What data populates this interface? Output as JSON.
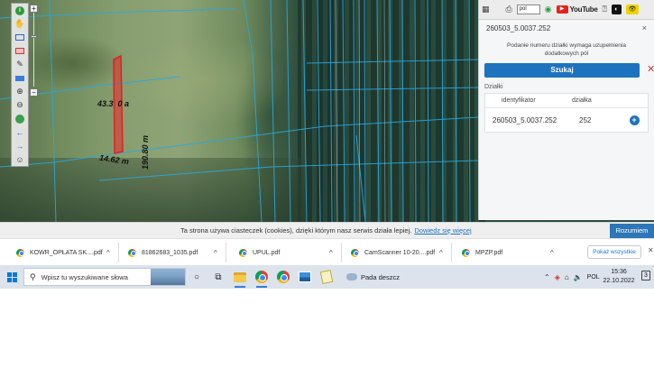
{
  "map": {
    "area_label": "43.3  0 a",
    "length_label_vertical": "190.80 m",
    "length_label_bottom": "14.62 m"
  },
  "panel": {
    "top_icons": [
      "calendar-icon",
      "printer-icon",
      "target-icon",
      "help-icon"
    ],
    "lang_value": "pol",
    "youtube_label": "YouTube",
    "contrast_label": "◐",
    "eye_label": "👁",
    "title": "260503_5.0037.252",
    "close_label": "×",
    "hint_text": "Podanie numeru działki wymaga uzupełnienia dodatkowych pól",
    "search_button": "Szukaj",
    "clear_label": "✕",
    "section_label": "Działki",
    "columns": [
      "identyfikator",
      "działka"
    ],
    "rows": [
      {
        "identyfikator": "260503_5.0037.252",
        "dzialka": "252",
        "action": "+"
      }
    ]
  },
  "cookie": {
    "text": "Ta strona używa ciasteczek (cookies), dzięki którym nasz serwis działa lepiej.",
    "link": "Dowiedz się więcej",
    "accept": "Rozumiem"
  },
  "downloads": {
    "items": [
      "KOWR_OPŁATA SK....pdf",
      "81862683_1035.pdf",
      "UPUL.pdf",
      "CamScanner 10-20....pdf",
      "MPZP.pdf"
    ],
    "show_all": "Pokaż wszystkie",
    "close": "✕"
  },
  "taskbar": {
    "search_placeholder": "Wpisz tu wyszukiwane słowa",
    "weather": "Pada deszcz",
    "time": "15:36",
    "date": "22.10.2022",
    "notifications": "3"
  }
}
